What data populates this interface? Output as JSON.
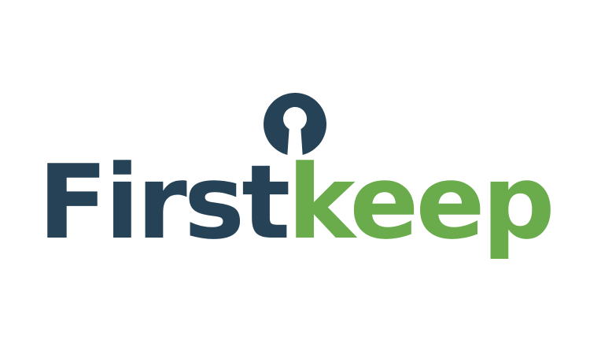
{
  "brand": {
    "name_part_1": "First",
    "name_part_2": "keep",
    "colors": {
      "navy": "#254257",
      "green": "#6aab4b",
      "background": "#ffffff"
    },
    "mark_icon": "keyhole-icon"
  }
}
